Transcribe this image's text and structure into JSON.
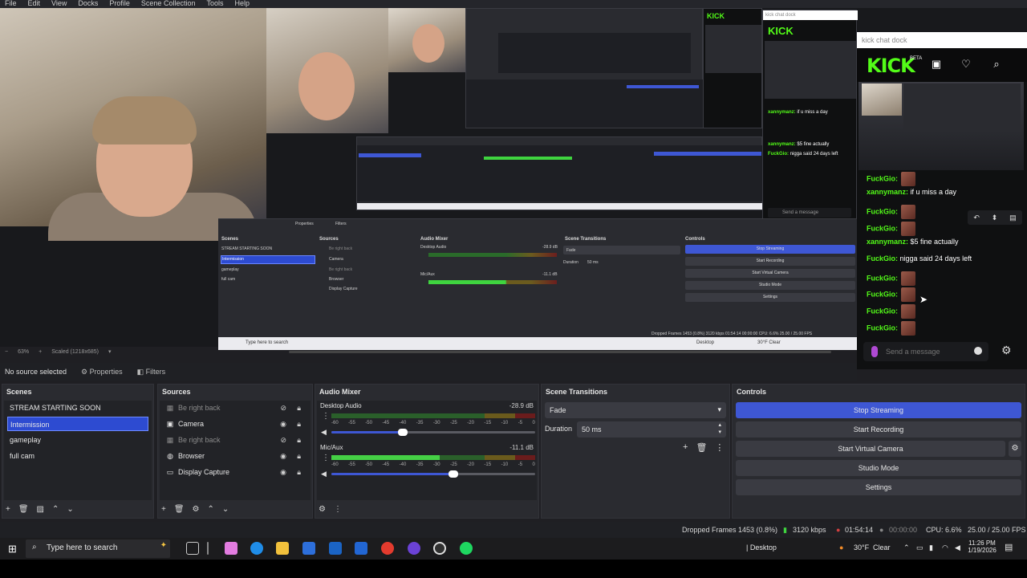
{
  "menu": [
    "File",
    "Edit",
    "View",
    "Docks",
    "Profile",
    "Scene Collection",
    "Tools",
    "Help"
  ],
  "preview": {
    "zoom": "63%",
    "scaled": "Scaled (1218x685)",
    "inner_scenes_title": "Scenes",
    "inner_scenes": [
      "STREAM STARTING SOON",
      "Intermission",
      "gameplay",
      "full cam"
    ],
    "inner_sources_title": "Sources",
    "inner_sources": [
      "Be right back",
      "Camera",
      "Be right back",
      "Browser",
      "Display Capture"
    ],
    "inner_mixer_title": "Audio Mixer",
    "inner_mixer": [
      {
        "name": "Desktop Audio",
        "db": "-28.9 dB"
      },
      {
        "name": "Mic/Aux",
        "db": "-11.1 dB"
      }
    ],
    "inner_transitions_title": "Scene Transitions",
    "inner_transition": "Fade",
    "inner_duration_label": "Duration",
    "inner_duration": "50 ms",
    "inner_controls_title": "Controls",
    "inner_controls": [
      "Stop Streaming",
      "Start Recording",
      "Start Virtual Camera",
      "Studio Mode",
      "Settings"
    ],
    "inner_properties": "Properties",
    "inner_filters": "Filters",
    "inner_search": "Type here to search",
    "inner_stats": "Dropped Frames 1453 (0.8%)   3120 kbps   01:54:14   00:00:00   CPU: 6.6%   25.00 / 25.00 FPS",
    "inner_weather": "30°F  Clear",
    "inner_desktop": "Desktop"
  },
  "chat": {
    "dock_title": "kick chat dock",
    "logo": "KICK",
    "beta": "BETA",
    "messages": [
      {
        "user": "FuckGio:",
        "text": "",
        "emote": true,
        "color": "#53fc18"
      },
      {
        "user": "xannymanz:",
        "text": " if u miss a day",
        "emote": false,
        "color": "#53fc18"
      },
      {
        "user": "FuckGio:",
        "text": "",
        "emote": true,
        "color": "#53fc18"
      },
      {
        "user": "FuckGio:",
        "text": "",
        "emote": true,
        "color": "#53fc18"
      },
      {
        "user": "xannymanz:",
        "text": " $5 fine actually",
        "emote": false,
        "color": "#53fc18"
      },
      {
        "user": "FuckGio:",
        "text": " nigga said 24 days left",
        "emote": false,
        "color": "#53fc18"
      },
      {
        "user": "FuckGio:",
        "text": "",
        "emote": true,
        "color": "#53fc18"
      },
      {
        "user": "FuckGio:",
        "text": "",
        "emote": true,
        "color": "#53fc18"
      },
      {
        "user": "FuckGio:",
        "text": "",
        "emote": true,
        "color": "#53fc18"
      },
      {
        "user": "FuckGio:",
        "text": "",
        "emote": true,
        "color": "#53fc18"
      }
    ],
    "send_placeholder": "Send a message",
    "nested_messages": [
      {
        "user": "xannymanz:",
        "text": " if u miss a day"
      },
      {
        "user": "xannymanz:",
        "text": " $5 fine actually"
      },
      {
        "user": "FuckGio:",
        "text": " nigga said 24 days left"
      }
    ]
  },
  "source_bar": {
    "no_source": "No source selected",
    "properties": "Properties",
    "filters": "Filters"
  },
  "scenes": {
    "title": "Scenes",
    "items": [
      "STREAM STARTING SOON",
      "Intermission",
      "gameplay",
      "full cam"
    ],
    "selected_index": 1
  },
  "sources": {
    "title": "Sources",
    "items": [
      {
        "label": "Be right back",
        "hidden": true
      },
      {
        "label": "Camera",
        "hidden": false
      },
      {
        "label": "Be right back",
        "hidden": true
      },
      {
        "label": "Browser",
        "hidden": false
      },
      {
        "label": "Display Capture",
        "hidden": false
      }
    ]
  },
  "mixer": {
    "title": "Audio Mixer",
    "scale": [
      "-60",
      "-55",
      "-50",
      "-45",
      "-40",
      "-35",
      "-30",
      "-25",
      "-20",
      "-15",
      "-10",
      "-5",
      "0"
    ],
    "channels": [
      {
        "name": "Desktop Audio",
        "db": "-28.9 dB",
        "level": 0.0,
        "volume": 0.35
      },
      {
        "name": "Mic/Aux",
        "db": "-11.1 dB",
        "level": 0.53,
        "volume": 0.6
      }
    ]
  },
  "transitions": {
    "title": "Scene Transitions",
    "selected": "Fade",
    "duration_label": "Duration",
    "duration": "50 ms"
  },
  "controls": {
    "title": "Controls",
    "stop_streaming": "Stop Streaming",
    "start_recording": "Start Recording",
    "start_virtual_camera": "Start Virtual Camera",
    "studio_mode": "Studio Mode",
    "settings": "Settings"
  },
  "status": {
    "dropped": "Dropped Frames 1453 (0.8%)",
    "kbps": "3120 kbps",
    "live": "01:54:14",
    "rec": "00:00:00",
    "cpu": "CPU: 6.6%",
    "fps": "25.00 / 25.00 FPS"
  },
  "taskbar": {
    "search_placeholder": "Type here to search",
    "desktop": "Desktop",
    "temp": "30°F",
    "weather": "Clear",
    "time": "11:26 PM",
    "date": "1/19/2026"
  },
  "colors": {
    "accent": "#3e57d4",
    "kick_green": "#53fc18"
  }
}
